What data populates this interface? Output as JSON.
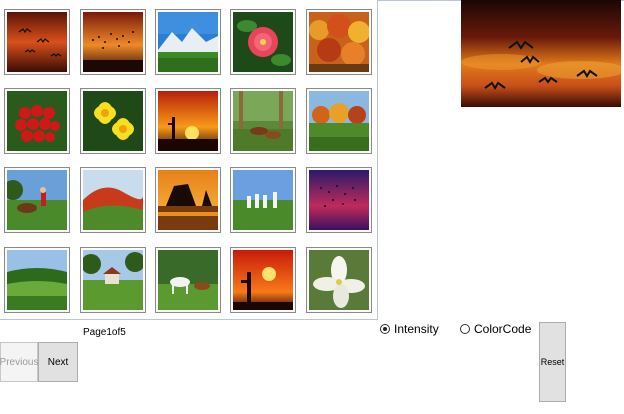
{
  "gallery": {
    "thumbnails": [
      {
        "subject": "birds-flying-at-sunset"
      },
      {
        "subject": "bird-flock-orange-sky"
      },
      {
        "subject": "snowy-mountains-meadow"
      },
      {
        "subject": "pink-rose-leaves"
      },
      {
        "subject": "autumn-forest"
      },
      {
        "subject": "red-berries"
      },
      {
        "subject": "yellow-daffodils"
      },
      {
        "subject": "desert-cactus-sunset"
      },
      {
        "subject": "horses-in-woods"
      },
      {
        "subject": "autumn-meadow-trees"
      },
      {
        "subject": "horse-and-rider"
      },
      {
        "subject": "red-hills-landscape"
      },
      {
        "subject": "rock-lake-sunset"
      },
      {
        "subject": "white-posts-field"
      },
      {
        "subject": "birds-purple-sky"
      },
      {
        "subject": "green-farmland"
      },
      {
        "subject": "village-in-valley"
      },
      {
        "subject": "white-horse-pasture"
      },
      {
        "subject": "cactus-sun-red-sky"
      },
      {
        "subject": "white-lily"
      }
    ]
  },
  "preview": {
    "subject": "birds-flying-at-sunset"
  },
  "pagination": {
    "page_text": "Page1of5",
    "previous_label": "Previous",
    "next_label": "Next",
    "previous_enabled": false
  },
  "options": {
    "intensity_label": "Intensity",
    "colorcode_label": "ColorCode",
    "selected": "Intensity"
  },
  "reset_label": "Reset"
}
